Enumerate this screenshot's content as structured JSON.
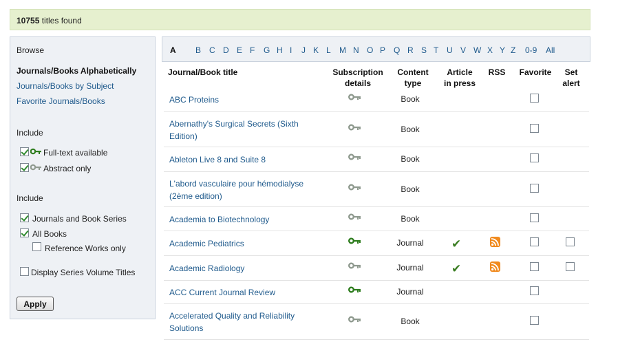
{
  "summary": {
    "count": "10755",
    "text": "titles found"
  },
  "sidebar": {
    "browse_heading": "Browse",
    "browse_items": [
      {
        "label": "Journals/Books Alphabetically",
        "active": true
      },
      {
        "label": "Journals/Books by Subject",
        "active": false
      },
      {
        "label": "Favorite Journals/Books",
        "active": false
      }
    ],
    "include1_heading": "Include",
    "include1_options": [
      {
        "label": "Full-text available",
        "checked": true,
        "icon": "key-icon-green"
      },
      {
        "label": "Abstract only",
        "checked": true,
        "icon": "key-icon-grey"
      }
    ],
    "include2_heading": "Include",
    "include2_options": [
      {
        "label": "Journals and Book Series",
        "checked": true
      },
      {
        "label": "All Books",
        "checked": true
      },
      {
        "label": "Reference Works only",
        "checked": false
      }
    ],
    "display_series": {
      "label": "Display Series Volume Titles",
      "checked": false
    },
    "apply_label": "Apply"
  },
  "alphabet": [
    "A",
    "B",
    "C",
    "D",
    "E",
    "F",
    "G",
    "H",
    "I",
    "J",
    "K",
    "L",
    "M",
    "N",
    "O",
    "P",
    "Q",
    "R",
    "S",
    "T",
    "U",
    "V",
    "W",
    "X",
    "Y",
    "Z",
    "0-9",
    "All"
  ],
  "alphabet_active": "A",
  "table": {
    "headers": {
      "title": "Journal/Book title",
      "subscription": [
        "Subscription",
        "details"
      ],
      "content_type": [
        "Content",
        "type"
      ],
      "article_in_press": [
        "Article",
        "in press"
      ],
      "rss": "RSS",
      "favorite": "Favorite",
      "set_alert": [
        "Set",
        "alert"
      ]
    },
    "rows": [
      {
        "title": [
          "ABC Proteins"
        ],
        "key": "grey",
        "type": "Book",
        "aip": false,
        "rss": false,
        "alert": false
      },
      {
        "title": [
          "Abernathy's Surgical Secrets (Sixth",
          "Edition)"
        ],
        "key": "grey",
        "type": "Book",
        "aip": false,
        "rss": false,
        "alert": false
      },
      {
        "title": [
          "Ableton Live 8 and Suite 8"
        ],
        "key": "grey",
        "type": "Book",
        "aip": false,
        "rss": false,
        "alert": false
      },
      {
        "title": [
          "L'abord vasculaire pour hémodialyse",
          "(2ème edition)"
        ],
        "key": "grey",
        "type": "Book",
        "aip": false,
        "rss": false,
        "alert": false
      },
      {
        "title": [
          "Academia to Biotechnology"
        ],
        "key": "grey",
        "type": "Book",
        "aip": false,
        "rss": false,
        "alert": false
      },
      {
        "title": [
          "Academic Pediatrics"
        ],
        "key": "green",
        "type": "Journal",
        "aip": true,
        "rss": true,
        "alert": true
      },
      {
        "title": [
          "Academic Radiology"
        ],
        "key": "grey",
        "type": "Journal",
        "aip": true,
        "rss": true,
        "alert": true
      },
      {
        "title": [
          "ACC Current Journal Review"
        ],
        "key": "green",
        "type": "Journal",
        "aip": false,
        "rss": false,
        "alert": false
      },
      {
        "title": [
          "Accelerated Quality and Reliability",
          "Solutions"
        ],
        "key": "grey",
        "type": "Book",
        "aip": false,
        "rss": false,
        "alert": false
      }
    ]
  },
  "colors": {
    "link": "#1f5a8c",
    "key_green": "#2e7d1e",
    "key_grey": "#8f9a8f",
    "rss": "#f08a1e",
    "tick": "#3a7d22",
    "summary_bg": "#e6f0cf",
    "panel_bg": "#eef1f5"
  }
}
